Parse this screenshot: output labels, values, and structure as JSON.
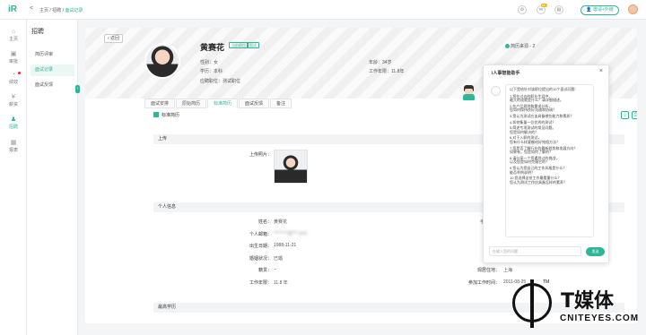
{
  "topbar": {
    "logo": "iR",
    "back": "<",
    "breadcrumb": [
      "主页",
      "招聘",
      "面试记录"
    ],
    "breadcrumb_sep": "/",
    "msg_badge": "99+",
    "invite_label": "邀请+外链"
  },
  "sidebar": {
    "items": [
      {
        "label": "主页",
        "icon": "home-icon"
      },
      {
        "label": "审批",
        "icon": "approval-icon"
      },
      {
        "label": "绩效",
        "icon": "performance-icon"
      },
      {
        "label": "薪资",
        "icon": "salary-icon"
      },
      {
        "label": "招聘",
        "icon": "recruit-icon"
      },
      {
        "label": "报表",
        "icon": "report-icon"
      }
    ]
  },
  "subnav": {
    "title": "招聘",
    "items": [
      "简历评审",
      "面试记录",
      "面试反馈"
    ]
  },
  "profile": {
    "back_label": "返回",
    "name": "黄赛花",
    "tags": [
      "当前职位",
      "面试"
    ],
    "gender_label": "性别：",
    "gender": "女",
    "age_label": "年龄：",
    "age": "34岁",
    "edu_label": "学历：",
    "edu": "本科",
    "work_years_label": "工作年限：",
    "work_years": "11.8年",
    "position_label": "应聘职位：",
    "position": "测试职位",
    "status": "简历来源 - 2"
  },
  "tabs": [
    "面试安排",
    "原始简历",
    "标准简历",
    "面试反馈",
    "备注"
  ],
  "section_title": "标准简历",
  "upload": {
    "bar": "上传",
    "photo_label": "上传照片："
  },
  "personal": {
    "bar": "个人信息",
    "name_label": "姓名：",
    "name": "黄赛花",
    "email_label": "个人邮箱：",
    "email": "********@***.com",
    "birth_label": "出生日期：",
    "birth": "1988-11-21",
    "marital_label": "婚姻状况：",
    "marital": "已婚",
    "origin_label": "籍贯：",
    "origin": "--",
    "city_label": "现居住地：",
    "city": "上海",
    "years_label": "工作年限：",
    "years": "11.8 年",
    "start_label": "参加工作时间：",
    "start": "2011-08-25",
    "right_label_partial": "手"
  },
  "education_bar": "最高学历",
  "ai": {
    "title": "i人事智能助手",
    "close": "×",
    "bubble": [
      "以下是给针对该职位提出的10个面试问题：",
      "1.您在过去的职业生涯中，\n最大的成就是什么？请详细描述。",
      "2.在产品规划和需求分析，\n您如何保持良好沟通和协调？",
      "3.您认为测试应该具备哪些能力和素质？",
      "4.如何衡量一位优秀的测试？",
      "5.简述专项测试的常见问题。\n您是如何解决的？",
      "6.对于入职的测试，\n您有什么样要额给好铭相方法？",
      "7.您是否了解行业的最新趋势和发展方向？\n如果有，您是如何了解的？",
      "8.请分享一个您遇到过的挑战，\n以及您是如何克服它的？",
      "9.您认为您自己的工作风格是什么？\n能否举例说明？",
      "10.您选择这份工作最看重什么？\n您认为测试工作应具备怎样的素养？"
    ],
    "input_placeholder": "在输入您的问题",
    "send_label": "发送"
  },
  "watermark": {
    "cn": "T媒体",
    "en": "CNITEYES.COM",
    "tm": "TM"
  },
  "colors": {
    "accent": "#2fb597",
    "bg": "#f3f5f7"
  }
}
